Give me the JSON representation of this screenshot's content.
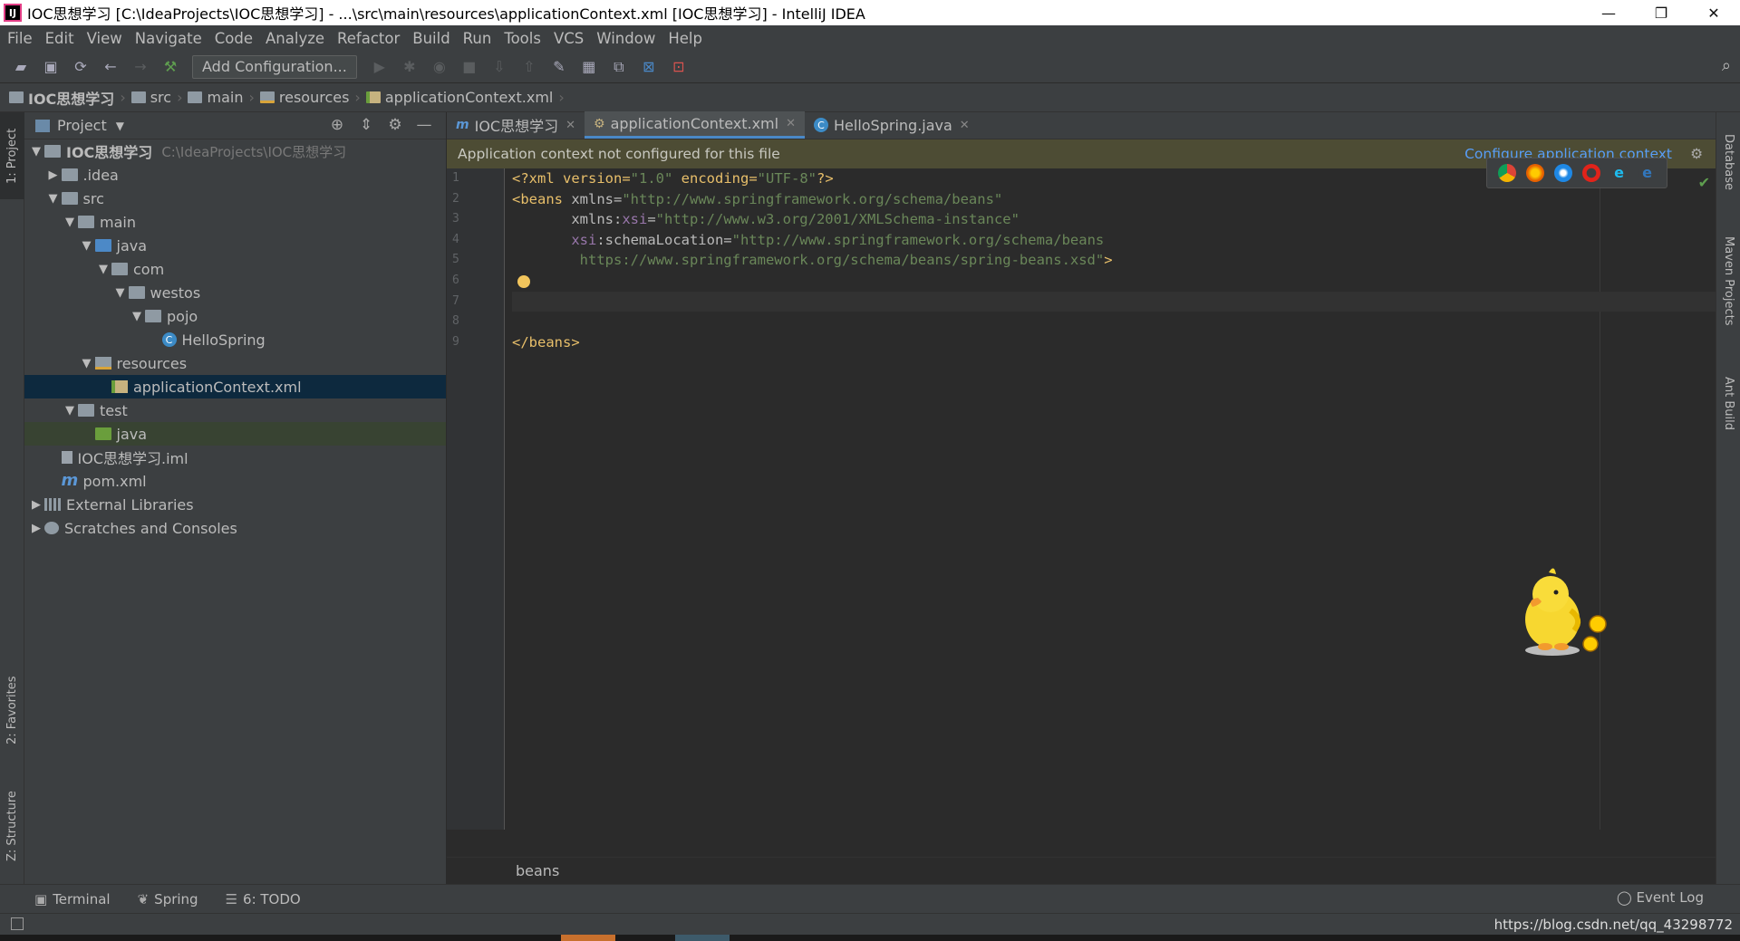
{
  "window": {
    "app_icon": "intellij-icon",
    "title": "IOC思想学习 [C:\\IdeaProjects\\IOC思想学习] - ...\\src\\main\\resources\\applicationContext.xml [IOC思想学习] - IntelliJ IDEA",
    "minimize": "—",
    "restore": "❐",
    "close": "✕"
  },
  "menu": [
    "File",
    "Edit",
    "View",
    "Navigate",
    "Code",
    "Analyze",
    "Refactor",
    "Build",
    "Run",
    "Tools",
    "VCS",
    "Window",
    "Help"
  ],
  "toolbar": {
    "add_configuration": "Add Configuration..."
  },
  "breadcrumbs": [
    "IOC思想学习",
    "src",
    "main",
    "resources",
    "applicationContext.xml"
  ],
  "left_tool_windows": {
    "project": "1: Project",
    "favorites": "2: Favorites",
    "structure": "Z: Structure"
  },
  "right_tool_windows": {
    "database": "Database",
    "maven": "Maven Projects",
    "ant": "Ant Build"
  },
  "project_panel": {
    "title": "Project",
    "tree": [
      {
        "label": "IOC思想学习",
        "path": "C:\\IdeaProjects\\IOC思想学习",
        "depth": 0,
        "expanded": true,
        "icon": "module-folder-icon"
      },
      {
        "label": ".idea",
        "depth": 1,
        "expanded": false,
        "icon": "folder-icon"
      },
      {
        "label": "src",
        "depth": 1,
        "expanded": true,
        "icon": "folder-icon"
      },
      {
        "label": "main",
        "depth": 2,
        "expanded": true,
        "icon": "folder-icon"
      },
      {
        "label": "java",
        "depth": 3,
        "expanded": true,
        "icon": "source-folder-icon"
      },
      {
        "label": "com",
        "depth": 4,
        "expanded": true,
        "icon": "package-icon"
      },
      {
        "label": "westos",
        "depth": 5,
        "expanded": true,
        "icon": "package-icon"
      },
      {
        "label": "pojo",
        "depth": 6,
        "expanded": true,
        "icon": "package-icon"
      },
      {
        "label": "HelloSpring",
        "depth": 7,
        "icon": "class-icon"
      },
      {
        "label": "resources",
        "depth": 3,
        "expanded": true,
        "icon": "resources-folder-icon"
      },
      {
        "label": "applicationContext.xml",
        "depth": 4,
        "icon": "spring-xml-icon",
        "selected": true
      },
      {
        "label": "test",
        "depth": 2,
        "expanded": true,
        "icon": "folder-icon"
      },
      {
        "label": "java",
        "depth": 3,
        "icon": "test-folder-icon",
        "highlighted": true
      },
      {
        "label": "IOC思想学习.iml",
        "depth": 1,
        "icon": "iml-file-icon"
      },
      {
        "label": "pom.xml",
        "depth": 1,
        "icon": "maven-icon"
      },
      {
        "label": "External Libraries",
        "depth": 0,
        "expanded": false,
        "icon": "library-icon"
      },
      {
        "label": "Scratches and Consoles",
        "depth": 0,
        "expanded": false,
        "icon": "scratches-icon"
      }
    ]
  },
  "editor_tabs": [
    {
      "label": "IOC思想学习",
      "icon": "m",
      "active": false
    },
    {
      "label": "applicationContext.xml",
      "icon": "⚙",
      "active": true
    },
    {
      "label": "HelloSpring.java",
      "icon": "C",
      "active": false
    }
  ],
  "banner": {
    "message": "Application context not configured for this file",
    "action": "Configure application context",
    "gear": "⚙"
  },
  "editor": {
    "line_numbers": [
      "1",
      "2",
      "3",
      "4",
      "5",
      "6",
      "7",
      "8",
      "9"
    ],
    "lines": [
      [
        {
          "c": "t",
          "v": "<?xml version="
        },
        {
          "c": "s",
          "v": "\"1.0\""
        },
        {
          "c": "t",
          "v": " encoding="
        },
        {
          "c": "s",
          "v": "\"UTF-8\""
        },
        {
          "c": "t",
          "v": "?>"
        }
      ],
      [
        {
          "c": "t",
          "v": "<beans "
        },
        {
          "c": "a",
          "v": "xmlns="
        },
        {
          "c": "s",
          "v": "\"http://www.springframework.org/schema/beans\""
        }
      ],
      [
        {
          "c": "a",
          "v": "       xmlns:"
        },
        {
          "c": "ns",
          "v": "xsi"
        },
        {
          "c": "a",
          "v": "="
        },
        {
          "c": "s",
          "v": "\"http://www.w3.org/2001/XMLSchema-instance\""
        }
      ],
      [
        {
          "c": "ns",
          "v": "       xsi"
        },
        {
          "c": "a",
          "v": ":schemaLocation="
        },
        {
          "c": "s",
          "v": "\"http://www.springframework.org/schema/beans"
        }
      ],
      [
        {
          "c": "s",
          "v": "        https://www.springframework.org/schema/beans/spring-beans.xsd\""
        },
        {
          "c": "t",
          "v": ">"
        }
      ],
      [],
      [],
      [],
      [
        {
          "c": "t",
          "v": "</beans>"
        }
      ]
    ],
    "breadcrumb": "beans"
  },
  "bottom_tools": [
    {
      "label": "Terminal",
      "icon": "terminal-icon"
    },
    {
      "label": "Spring",
      "icon": "spring-icon"
    },
    {
      "label": "6: TODO",
      "icon": "todo-icon"
    }
  ],
  "event_log": "Event Log",
  "watermark": "https://blog.csdn.net/qq_43298772",
  "colors": {
    "accent": "#4a88c7",
    "selection": "#0d293e",
    "banner_bg": "#4d4c34",
    "link": "#589df6"
  }
}
